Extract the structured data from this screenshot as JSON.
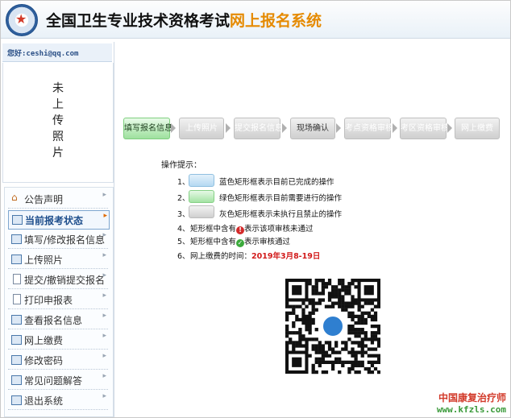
{
  "header": {
    "title_main": "全国卫生专业技术资格考试",
    "title_accent": "网上报名系统"
  },
  "user": {
    "greeting": "您好:ceshi@qq.com"
  },
  "photo": {
    "placeholder": "未上传照片"
  },
  "menu": {
    "items": [
      {
        "label": "公告声明",
        "icon": "house-icon"
      },
      {
        "label": "当前报考状态",
        "icon": "list-icon",
        "active": true
      },
      {
        "label": "填写/修改报名信息",
        "icon": "form-icon"
      },
      {
        "label": "上传照片",
        "icon": "photo-icon"
      },
      {
        "label": "提交/撤销提交报名",
        "icon": "document-icon"
      },
      {
        "label": "打印申报表",
        "icon": "document-icon"
      },
      {
        "label": "查看报名信息",
        "icon": "list-icon"
      },
      {
        "label": "网上缴费",
        "icon": "list-icon"
      },
      {
        "label": "修改密码",
        "icon": "list-icon"
      },
      {
        "label": "常见问题解答",
        "icon": "list-icon"
      },
      {
        "label": "退出系统",
        "icon": "list-icon"
      }
    ]
  },
  "steps": [
    {
      "label": "填写报名信息",
      "state": "current"
    },
    {
      "label": "上传照片",
      "state": "disabled"
    },
    {
      "label": "提交报名信息",
      "state": "disabled"
    },
    {
      "label": "现场确认",
      "state": "disabled-dark"
    },
    {
      "label": "考点资格审核",
      "state": "disabled"
    },
    {
      "label": "考区资格审核",
      "state": "disabled"
    },
    {
      "label": "网上缴费",
      "state": "disabled"
    }
  ],
  "tips": {
    "title": "操作提示：",
    "items": [
      {
        "num": "1、",
        "text": "蓝色矩形框表示目前已完成的操作"
      },
      {
        "num": "2、",
        "text": "绿色矩形框表示目前需要进行的操作"
      },
      {
        "num": "3、",
        "text": "灰色矩形框表示未执行且禁止的操作"
      },
      {
        "num": "4、",
        "text_before": "矩形框中含有",
        "text_after": "表示该项审核未通过"
      },
      {
        "num": "5、",
        "text_before": "矩形框中含有",
        "text_after": "表示审核通过"
      },
      {
        "num": "6、",
        "text_before": "网上缴费的时间：",
        "date": "2019年3月8-19日"
      }
    ]
  },
  "watermark": {
    "line1": "中国康复治疗师",
    "line2": "www.kfzls.com"
  },
  "colors": {
    "accent": "#e58a00",
    "date": "#d21b1b",
    "current_step": "#9ee09e",
    "disabled_step": "#cfcfcf"
  }
}
